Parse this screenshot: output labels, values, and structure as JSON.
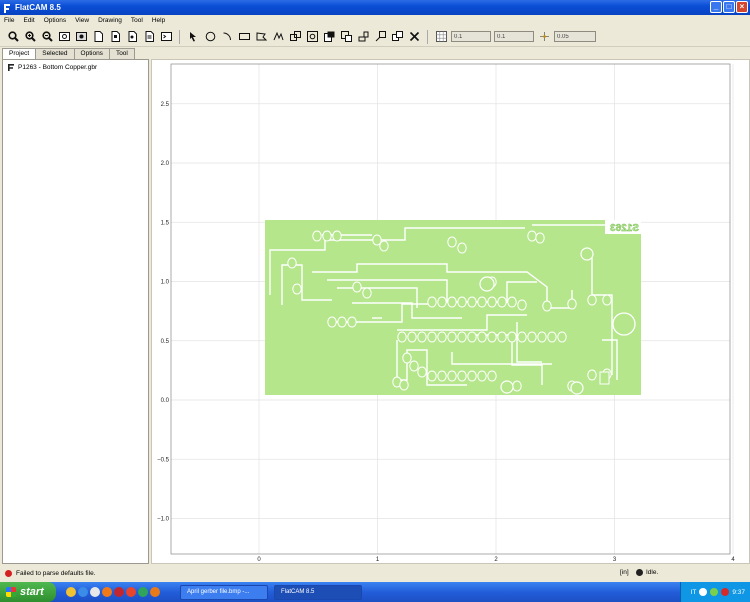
{
  "window": {
    "title": "FlatCAM 8.5"
  },
  "menu": [
    "File",
    "Edit",
    "Options",
    "View",
    "Drawing",
    "Tool",
    "Help"
  ],
  "toolbar": {
    "icons": [
      "zoom-fit-icon",
      "zoom-in-icon",
      "zoom-out-icon",
      "clear-plot-icon",
      "replot-icon",
      "new-project-icon",
      "open-gerber-icon",
      "open-excellon-icon",
      "open-gcode-icon",
      "shell-icon",
      "select-icon",
      "circle-icon",
      "arc-icon",
      "rectangle-icon",
      "polygon-icon",
      "path-icon",
      "union-icon",
      "intersection-icon",
      "subtract-icon",
      "buffer-icon",
      "paint-icon",
      "move-icon",
      "copy-icon",
      "delete-icon",
      "grid-icon",
      "snap-icon"
    ],
    "grid_x": "0.1",
    "grid_y": "0.1",
    "snap_max": "0.05"
  },
  "tabs": [
    "Project",
    "Selected",
    "Options",
    "Tool"
  ],
  "project": {
    "items": [
      "P1263 - Bottom Copper.gbr"
    ]
  },
  "plot": {
    "x_ticks": [
      "0",
      "1",
      "2",
      "3",
      "4"
    ],
    "y_ticks": [
      "2.5",
      "2.0",
      "1.5",
      "1.0",
      "0.5",
      "0.0",
      "−0.5",
      "−1.0"
    ],
    "board_label": "S1263",
    "copper_color": "#b5e68c"
  },
  "status": {
    "message": "Failed to parse defaults file.",
    "units": "[in]",
    "state": "Idle."
  },
  "taskbar": {
    "start": "start",
    "tasks": [
      "April gerber file.bmp -...",
      "FlatCAM 8.5"
    ],
    "clock": "9:37",
    "lang": "IT"
  }
}
